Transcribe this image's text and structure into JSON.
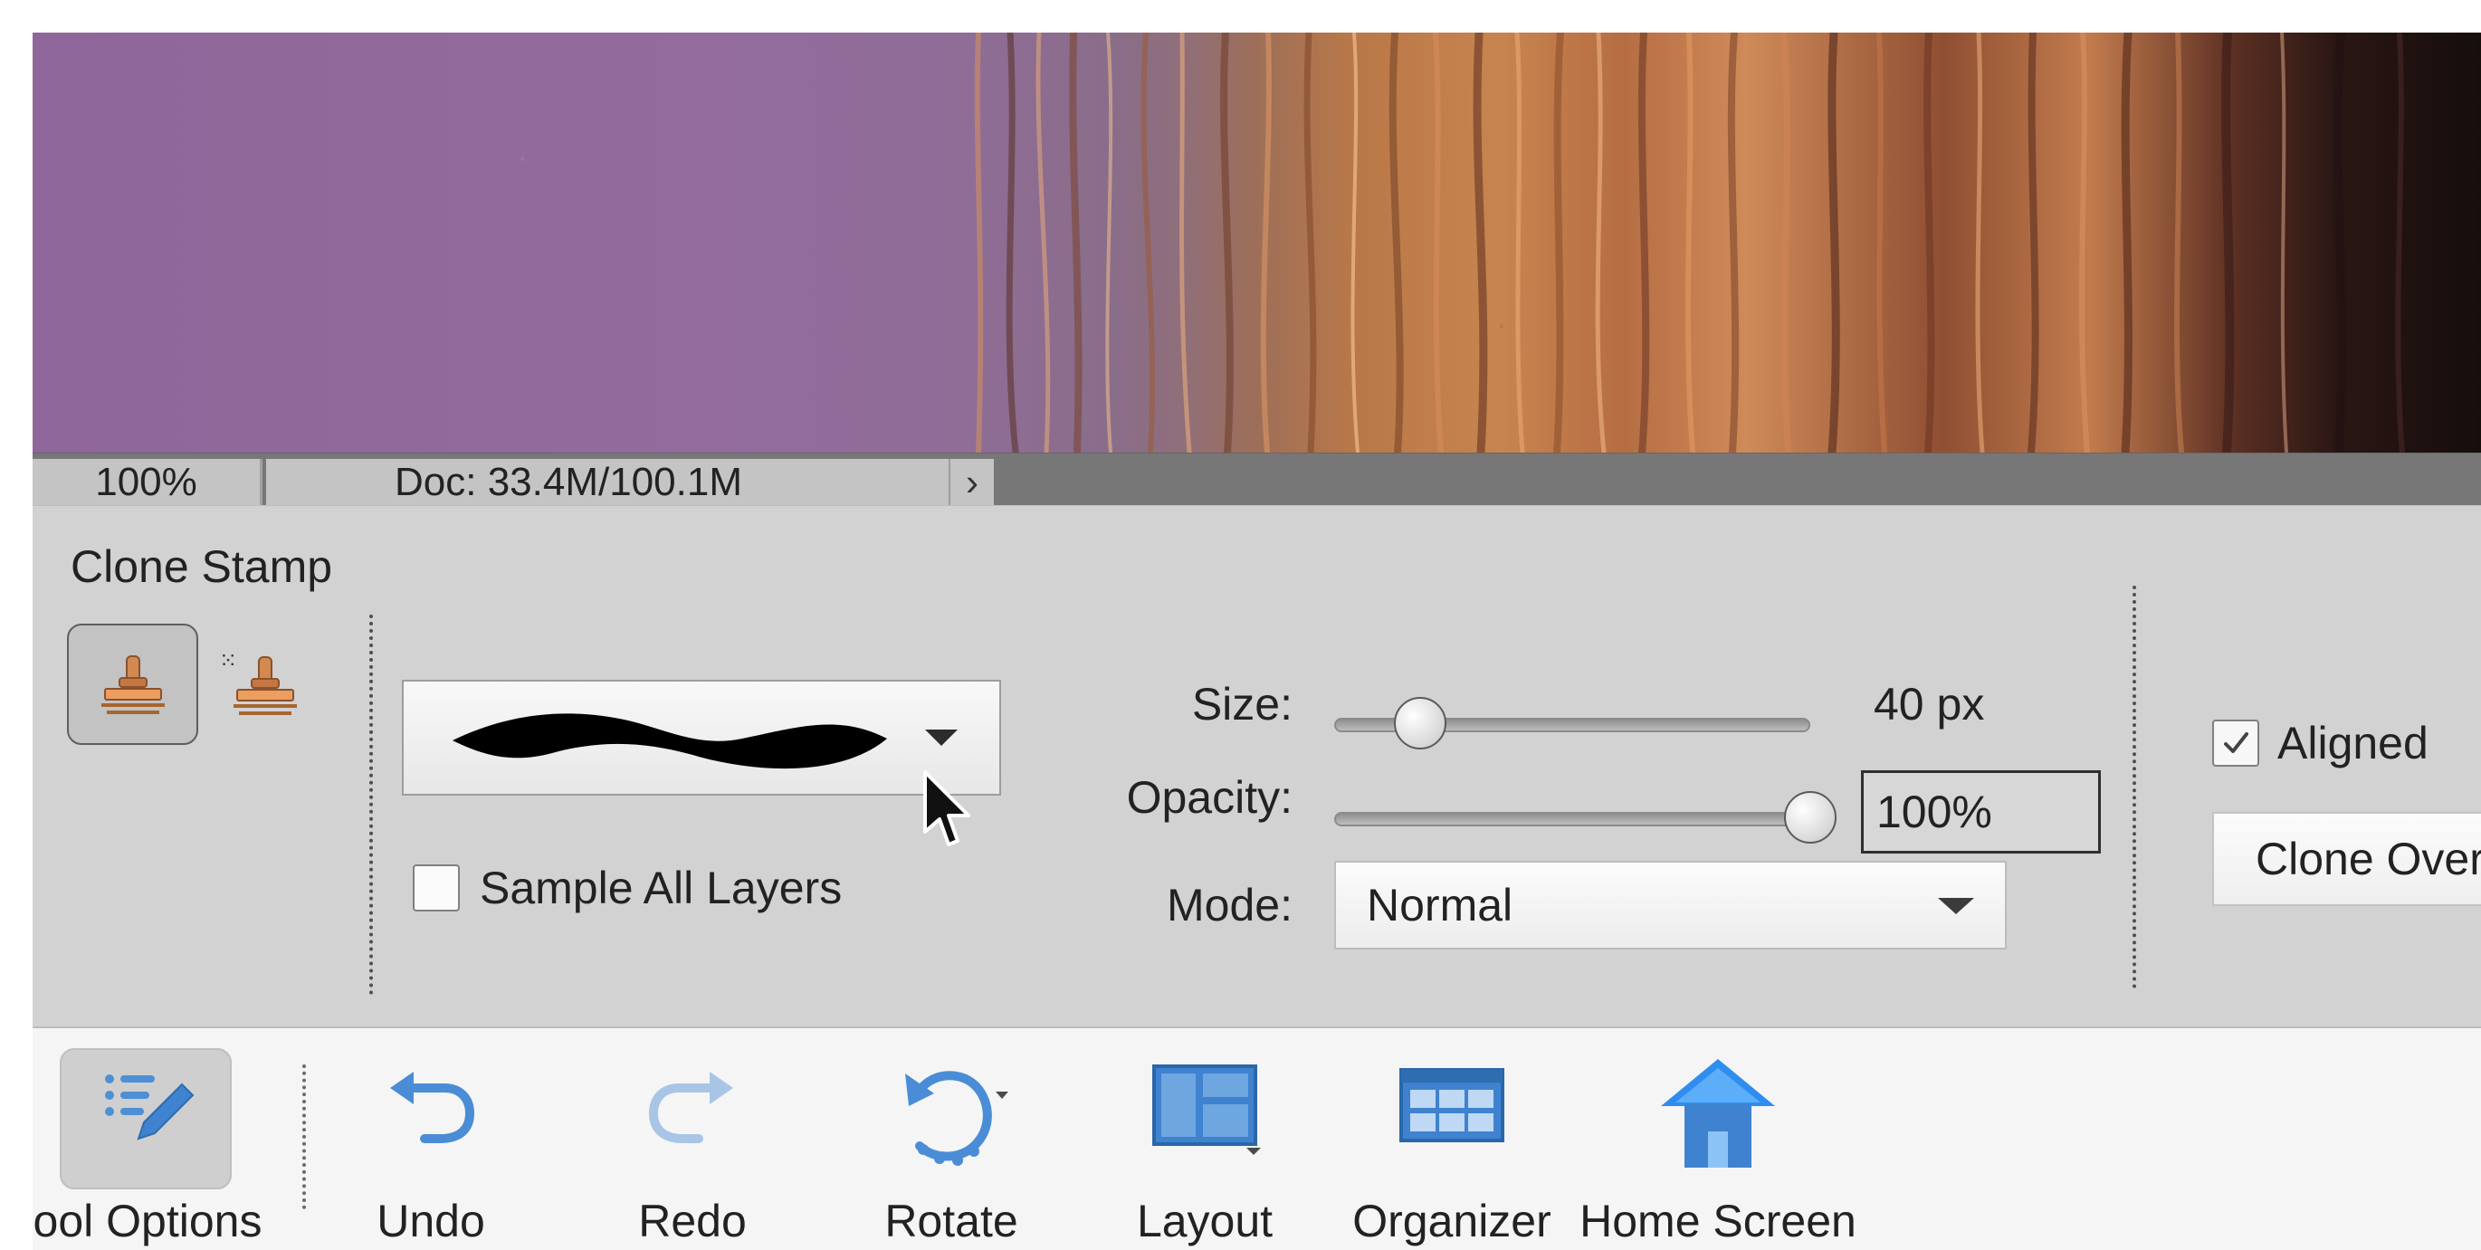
{
  "canvas": {
    "content": "Hair image preview",
    "accent_colors": {
      "purple_background": "#8f6699",
      "hair_orange": "#c7844f",
      "hair_dark": "#160d0d"
    }
  },
  "status_bar": {
    "zoom": "100%",
    "document_size": "Doc: 33.4M/100.1M",
    "arrow": "›"
  },
  "tool_options": {
    "title": "Clone Stamp",
    "icons": {
      "clone_stamp": "clone-stamp-icon",
      "pattern_stamp": "pattern-stamp-icon",
      "brush_preset": "brush-stroke-icon",
      "dropdown": "dropdown-caret-icon",
      "cursor": "mouse-pointer-icon",
      "checkmark": "checkmark-icon"
    },
    "sample_all_layers_label": "Sample All Layers",
    "size_label": "Size:",
    "size_value": "40 px",
    "size_level": 0.18,
    "opacity_label": "Opacity:",
    "opacity_value": "100%",
    "opacity_level": 1.0,
    "mode_label": "Mode:",
    "mode_value": "Normal",
    "aligned_label": "Aligned",
    "aligned_checked": true,
    "clone_overlay_label": "Clone Overl"
  },
  "taskbar": {
    "items": [
      {
        "label": "ool Options",
        "icon": "tool-options-icon"
      },
      {
        "label": "Undo",
        "icon": "undo-icon"
      },
      {
        "label": "Redo",
        "icon": "redo-icon"
      },
      {
        "label": "Rotate",
        "icon": "rotate-icon"
      },
      {
        "label": "Layout",
        "icon": "layout-icon"
      },
      {
        "label": "Organizer",
        "icon": "organizer-icon"
      },
      {
        "label": "Home Screen",
        "icon": "home-icon"
      }
    ]
  }
}
